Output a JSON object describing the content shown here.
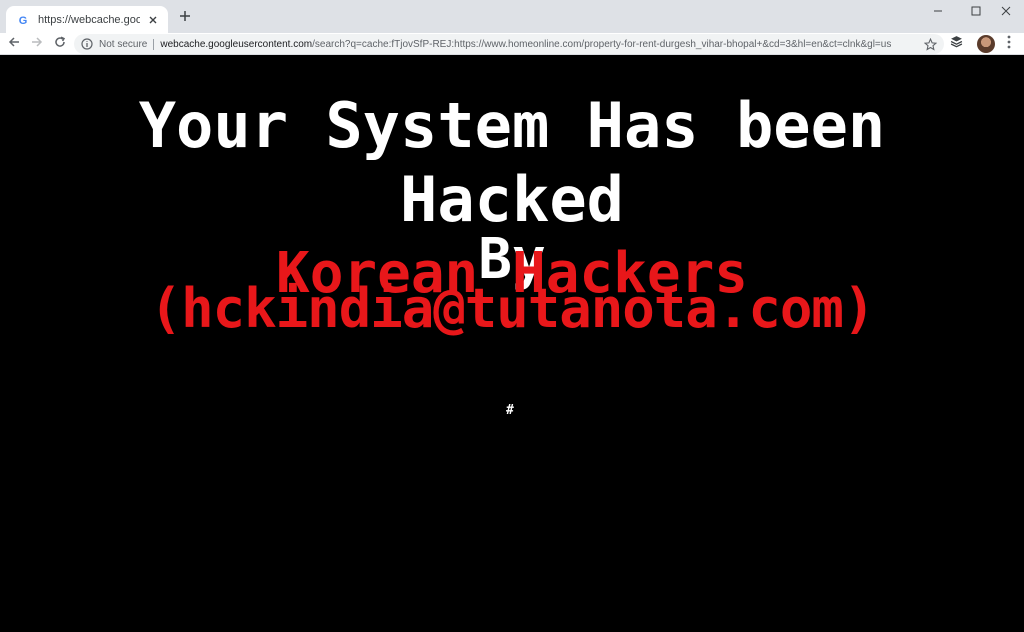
{
  "browser": {
    "tab_title": "https://webcache.googleuserco",
    "new_tab_label": "+",
    "security_label": "Not secure",
    "url_host": "webcache.googleusercontent.com",
    "url_path": "/search?q=cache:fTjovSfP-REJ:https://www.homeonline.com/property-for-rent-durgesh_vihar-bhopal+&cd=3&hl=en&ct=clnk&gl=us",
    "icons": [
      "google-favicon",
      "close-icon",
      "plus-icon",
      "minimize-icon",
      "maximize-icon",
      "window-close-icon",
      "back-arrow-icon",
      "forward-arrow-icon",
      "reload-icon",
      "info-icon",
      "star-icon",
      "extension-icon",
      "menu-dots-icon"
    ]
  },
  "page": {
    "line1": "Your System Has been",
    "line2": "Hacked",
    "line3": "By",
    "red_line1": "Korean Hackers",
    "red_line2": "(hckindia@tutanota.com)",
    "hash": "#",
    "colors": {
      "background": "#000000",
      "white_text": "#ffffff",
      "red_text": "#e8171a"
    }
  }
}
